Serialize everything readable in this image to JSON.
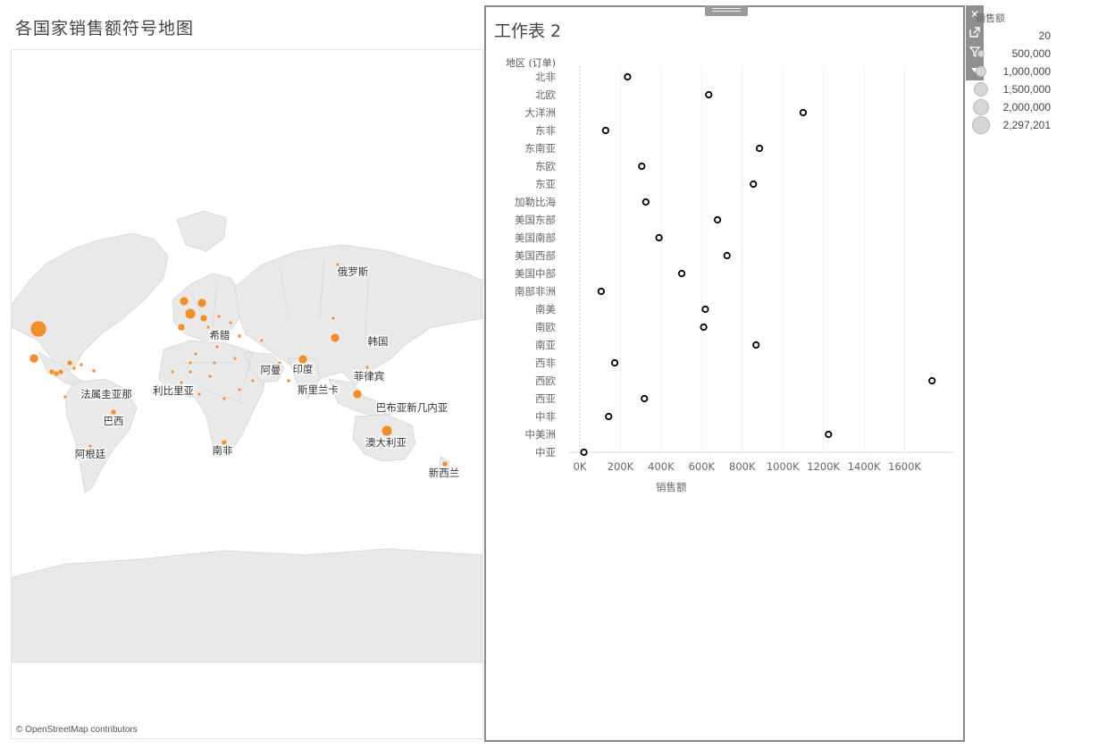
{
  "map": {
    "title": "各国家销售额符号地图",
    "attribution": "© OpenStreetMap contributors",
    "labels": [
      "俄罗斯",
      "希腊",
      "韩国",
      "阿曼",
      "印度",
      "菲律宾",
      "斯里兰卡",
      "利比里亚",
      "法属圭亚那",
      "巴西",
      "巴布亚新几内亚",
      "澳大利亚",
      "阿根廷",
      "南非",
      "新西兰"
    ],
    "marker_color": "#f28e2b"
  },
  "worksheet": {
    "title": "工作表 2",
    "toolbar_icons": [
      "close-icon",
      "popout-icon",
      "filter-icon",
      "dropdown-icon"
    ]
  },
  "legend": {
    "title": "销售额",
    "items": [
      "20",
      "500,000",
      "1,000,000",
      "1,500,000",
      "2,000,000",
      "2,297,201"
    ]
  },
  "chart_data": {
    "type": "scatter",
    "row_header": "地区 (订单)",
    "xlabel": "销售额",
    "x_ticks": [
      "0K",
      "200K",
      "400K",
      "600K",
      "800K",
      "1000K",
      "1200K",
      "1400K",
      "1600K"
    ],
    "xlim": [
      0,
      1800000
    ],
    "grid": true,
    "categories": [
      "北非",
      "北欧",
      "大洋洲",
      "东非",
      "东南亚",
      "东欧",
      "东亚",
      "加勒比海",
      "美国东部",
      "美国南部",
      "美国西部",
      "美国中部",
      "南部非洲",
      "南美",
      "南欧",
      "南亚",
      "西非",
      "西欧",
      "西亚",
      "中非",
      "中美洲",
      "中亚"
    ],
    "values": [
      235000,
      635000,
      1100000,
      127000,
      885000,
      305000,
      855000,
      325000,
      678000,
      390000,
      725000,
      502000,
      105000,
      618000,
      610000,
      868000,
      172000,
      1735000,
      318000,
      142000,
      1225000,
      20000
    ]
  }
}
